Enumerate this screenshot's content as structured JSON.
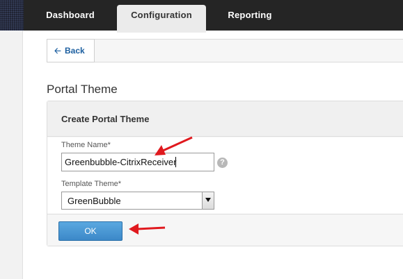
{
  "topnav": {
    "tabs": [
      {
        "label": "Dashboard",
        "active": false
      },
      {
        "label": "Configuration",
        "active": true
      },
      {
        "label": "Reporting",
        "active": false
      }
    ]
  },
  "back": {
    "label": "Back",
    "icon": "arrow-left-icon"
  },
  "page": {
    "title": "Portal Theme"
  },
  "form": {
    "title": "Create Portal Theme",
    "theme_name_label": "Theme Name*",
    "theme_name_value": "Greenbubble-CitrixReceiver",
    "help_icon": "question-mark-icon",
    "template_label": "Template Theme*",
    "template_value": "GreenBubble",
    "ok_label": "OK"
  },
  "colors": {
    "topbar": "#252525",
    "primary_button": "#3c88c8",
    "annotation_arrow": "#e0191e"
  }
}
